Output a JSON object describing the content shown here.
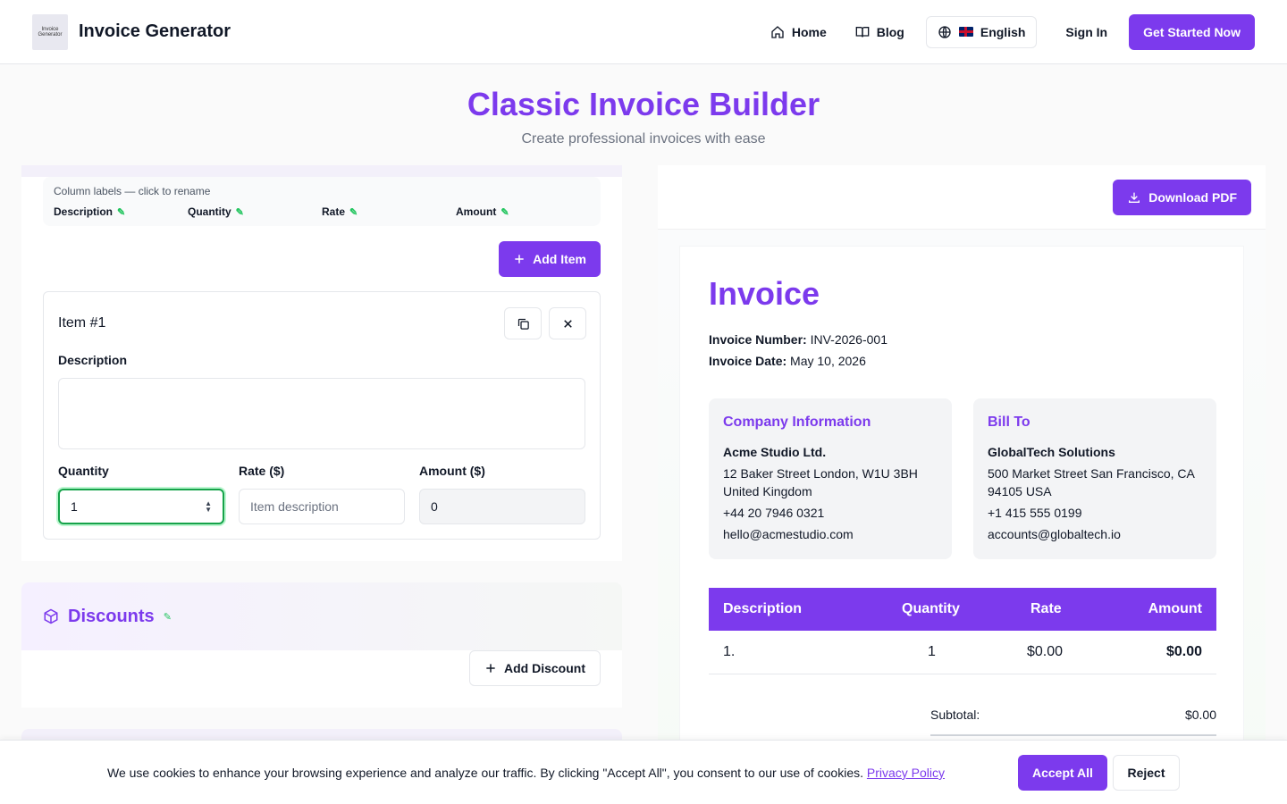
{
  "header": {
    "logo_text": "Invoice Generator",
    "brand": "Invoice Generator",
    "nav": {
      "home": "Home",
      "blog": "Blog",
      "language": "English",
      "signin": "Sign In",
      "cta": "Get Started Now"
    }
  },
  "hero": {
    "title": "Classic Invoice Builder",
    "subtitle": "Create professional invoices with ease"
  },
  "editor": {
    "column_labels_hint": "Column labels — click to rename",
    "column_labels": [
      "Description",
      "Quantity",
      "Rate",
      "Amount"
    ],
    "add_item_label": "Add Item",
    "item": {
      "title": "Item #1",
      "description_label": "Description",
      "description_value": "",
      "quantity_label": "Quantity",
      "quantity_value": "1",
      "rate_label": "Rate ($)",
      "rate_placeholder": "Item description",
      "amount_label": "Amount ($)",
      "amount_value": "0"
    },
    "discounts": {
      "title": "Discounts",
      "add_label": "Add Discount"
    }
  },
  "preview": {
    "download_label": "Download PDF",
    "title": "Invoice",
    "invoice_number_label": "Invoice Number:",
    "invoice_number": "INV-2026-001",
    "invoice_date_label": "Invoice Date:",
    "invoice_date": "May 10, 2026",
    "company": {
      "heading": "Company Information",
      "name": "Acme Studio Ltd.",
      "address": "12 Baker Street London, W1U 3BH United Kingdom",
      "phone": "+44 20 7946 0321",
      "email": "hello@acmestudio.com"
    },
    "bill_to": {
      "heading": "Bill To",
      "name": "GlobalTech Solutions",
      "address": "500 Market Street San Francisco, CA 94105 USA",
      "phone": "+1 415 555 0199",
      "email": "accounts@globaltech.io"
    },
    "table": {
      "headers": [
        "Description",
        "Quantity",
        "Rate",
        "Amount"
      ],
      "rows": [
        {
          "description": "1.",
          "quantity": "1",
          "rate": "$0.00",
          "amount": "$0.00"
        }
      ]
    },
    "subtotal_label": "Subtotal:",
    "subtotal_value": "$0.00"
  },
  "cookie": {
    "text": "We use cookies to enhance your browsing experience and analyze our traffic. By clicking \"Accept All\", you consent to our use of cookies.",
    "link": "Privacy Policy",
    "accept": "Accept All",
    "reject": "Reject"
  },
  "colors": {
    "accent": "#7c3aed",
    "focus": "#16a34a"
  }
}
